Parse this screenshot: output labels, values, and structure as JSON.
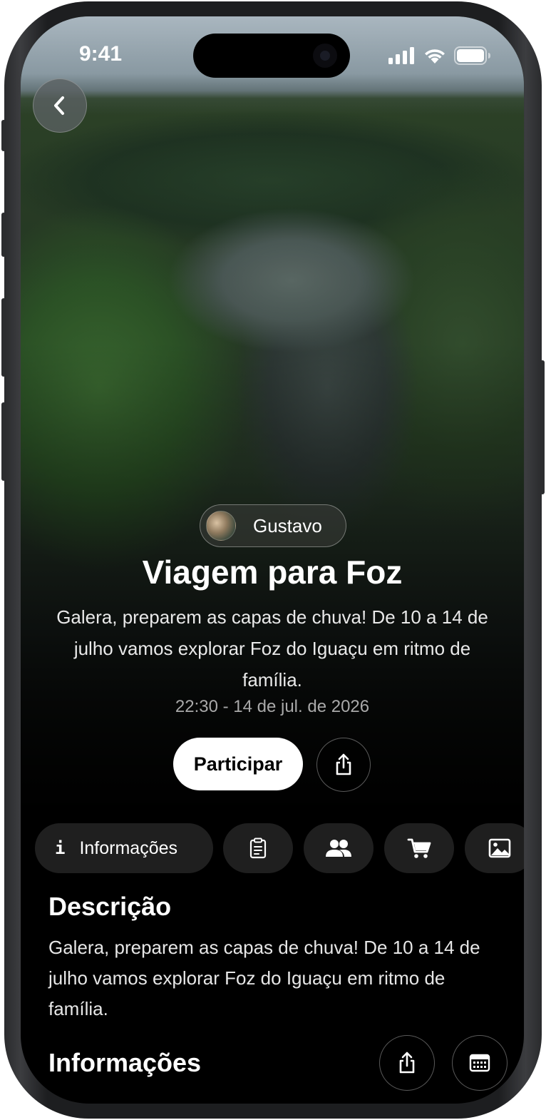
{
  "status_bar": {
    "time": "9:41"
  },
  "event": {
    "host_name": "Gustavo",
    "title": "Viagem para Foz",
    "subtitle": "Galera, preparem as capas de chuva! De 10 a 14 de julho vamos explorar Foz do Iguaçu em ritmo de família.",
    "datetime": "22:30 - 14 de jul. de 2026",
    "join_label": "Participar"
  },
  "tabs": [
    {
      "label": "Informações",
      "icon": "info-icon",
      "active": true
    },
    {
      "icon": "clipboard-icon"
    },
    {
      "icon": "people-icon"
    },
    {
      "icon": "cart-icon"
    },
    {
      "icon": "image-icon"
    }
  ],
  "description": {
    "heading": "Descrição",
    "text": "Galera, preparem as capas de chuva! De 10 a 14 de julho vamos explorar Foz do Iguaçu em ritmo de família."
  },
  "info_section": {
    "heading": "Informações"
  },
  "colors": {
    "background": "#000000",
    "chip": "#1f1f1f",
    "primary_button": "#ffffff"
  }
}
